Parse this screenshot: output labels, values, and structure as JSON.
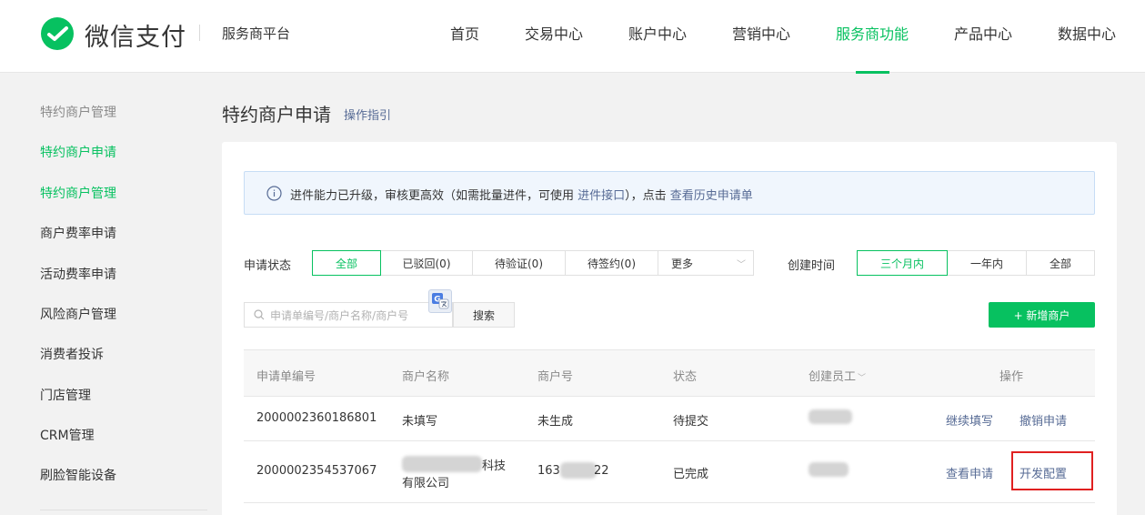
{
  "header": {
    "logo_text": "微信支付",
    "platform": "服务商平台",
    "nav": [
      "首页",
      "交易中心",
      "账户中心",
      "营销中心",
      "服务商功能",
      "产品中心",
      "数据中心"
    ],
    "active_nav": "服务商功能"
  },
  "sidebar": {
    "items": [
      "特约商户管理",
      "特约商户申请",
      "特约商户管理",
      "商户费率申请",
      "活动费率申请",
      "风险商户管理",
      "消费者投诉",
      "门店管理",
      "CRM管理",
      "刷脸智能设备"
    ]
  },
  "main": {
    "title": "特约商户申请",
    "guide_link": "操作指引",
    "notice": {
      "prefix": "进件能力已升级，审核更高效（如需批量进件，可使用 ",
      "link1": "进件接口",
      "middle": "），点击 ",
      "link2": "查看历史申请单"
    },
    "status_filter": {
      "label": "申请状态",
      "options": [
        "全部",
        "已驳回(0)",
        "待验证(0)",
        "待签约(0)",
        "更多"
      ],
      "selected": "全部"
    },
    "time_filter": {
      "label": "创建时间",
      "options": [
        "三个月内",
        "一年内",
        "全部"
      ],
      "selected": "三个月内"
    },
    "search": {
      "placeholder": "申请单编号/商户名称/商户号",
      "button": "搜索"
    },
    "add_button": "+ 新增商户",
    "table": {
      "headers": [
        "申请单编号",
        "商户名称",
        "商户号",
        "状态",
        "创建员工",
        "操作"
      ],
      "rows": [
        {
          "id": "2000002360186801",
          "name": "未填写",
          "merchant_no": "未生成",
          "status": "待提交",
          "actions": [
            "继续填写",
            "撤销申请"
          ]
        },
        {
          "id": "2000002354537067",
          "name_line1": "科技",
          "name_line2": "有限公司",
          "merchant_no_prefix": "163",
          "merchant_no_suffix": "22",
          "status": "已完成",
          "actions": [
            "查看申请",
            "开发配置"
          ]
        }
      ]
    }
  },
  "colors": {
    "brand": "#07c160",
    "link": "#576b95",
    "highlight": "#e02020"
  }
}
